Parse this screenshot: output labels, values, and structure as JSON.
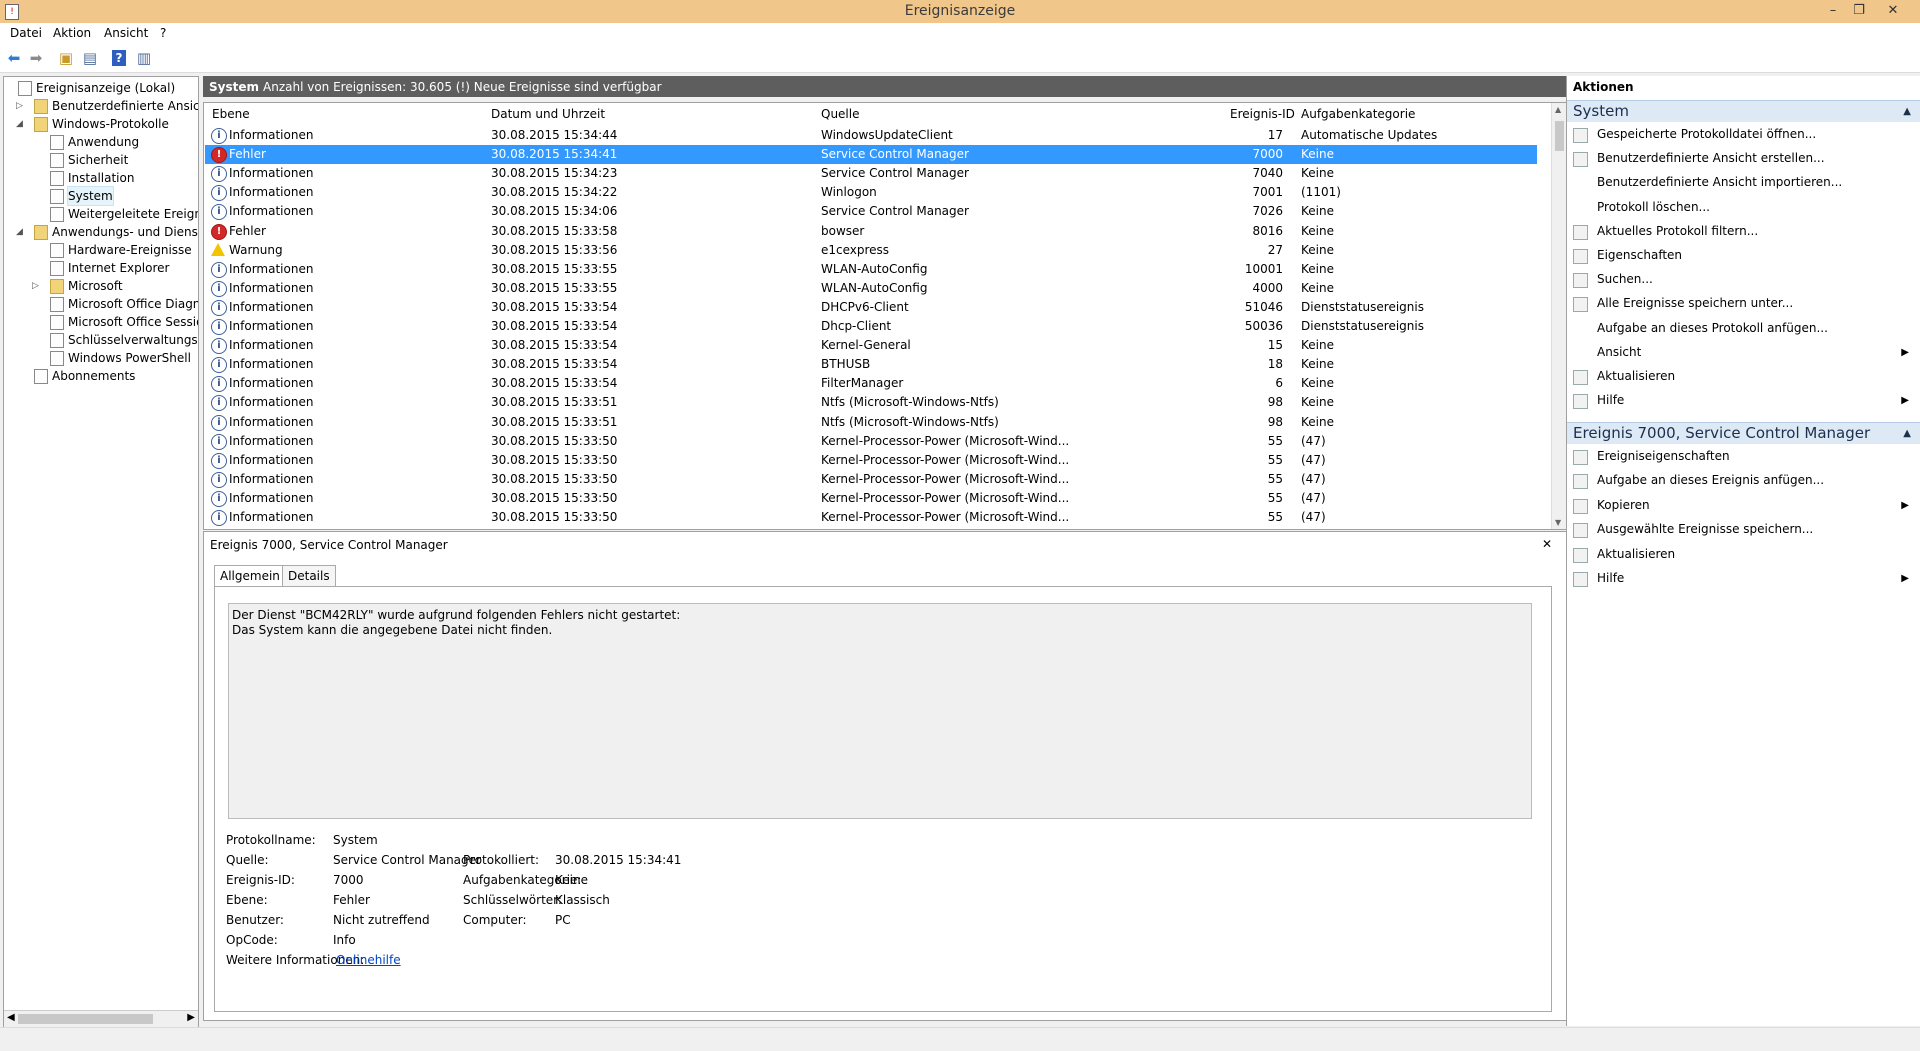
{
  "window": {
    "title": "Ereignisanzeige",
    "minimize": "–",
    "restore": "❐",
    "close": "✕"
  },
  "menu": [
    "Datei",
    "Aktion",
    "Ansicht",
    "?"
  ],
  "toolbar": [
    "back-icon",
    "forward-icon",
    "folder-up-icon",
    "console-tree-icon",
    "help-icon",
    "show-pane-icon"
  ],
  "tree": [
    {
      "label": "Ereignisanzeige (Lokal)",
      "level": 0,
      "expander": "",
      "icon": "eventviewer-icon"
    },
    {
      "label": "Benutzerdefinierte Ansichten",
      "level": 1,
      "expander": "▷",
      "icon": "folder-icon"
    },
    {
      "label": "Windows-Protokolle",
      "level": 1,
      "expander": "◢",
      "icon": "folder-icon"
    },
    {
      "label": "Anwendung",
      "level": 2,
      "expander": "",
      "icon": "log-icon"
    },
    {
      "label": "Sicherheit",
      "level": 2,
      "expander": "",
      "icon": "log-icon"
    },
    {
      "label": "Installation",
      "level": 2,
      "expander": "",
      "icon": "log-icon"
    },
    {
      "label": "System",
      "level": 2,
      "expander": "",
      "icon": "log-icon",
      "selected": true
    },
    {
      "label": "Weitergeleitete Ereignisse",
      "level": 2,
      "expander": "",
      "icon": "log-icon"
    },
    {
      "label": "Anwendungs- und Dienstprotokolle",
      "level": 1,
      "expander": "◢",
      "icon": "folder-icon"
    },
    {
      "label": "Hardware-Ereignisse",
      "level": 2,
      "expander": "",
      "icon": "log-icon"
    },
    {
      "label": "Internet Explorer",
      "level": 2,
      "expander": "",
      "icon": "log-icon"
    },
    {
      "label": "Microsoft",
      "level": 2,
      "expander": "▷",
      "icon": "folder-icon"
    },
    {
      "label": "Microsoft Office Diagnostics",
      "level": 2,
      "expander": "",
      "icon": "log-icon"
    },
    {
      "label": "Microsoft Office Sessions",
      "level": 2,
      "expander": "",
      "icon": "log-icon"
    },
    {
      "label": "Schlüsselverwaltungsdienst",
      "level": 2,
      "expander": "",
      "icon": "log-icon"
    },
    {
      "label": "Windows PowerShell",
      "level": 2,
      "expander": "",
      "icon": "log-icon"
    },
    {
      "label": "Abonnements",
      "level": 1,
      "expander": "",
      "icon": "subscription-icon"
    }
  ],
  "header": {
    "log_name": "System",
    "summary": "Anzahl von Ereignissen: 30.605 (!) Neue Ereignisse sind verfügbar"
  },
  "columns": [
    "Ebene",
    "Datum und Uhrzeit",
    "Quelle",
    "Ereignis-ID",
    "Aufgabenkategorie"
  ],
  "events": [
    {
      "level": "Informationen",
      "type": "info",
      "date": "30.08.2015 15:34:44",
      "source": "WindowsUpdateClient",
      "id": "17",
      "category": "Automatische Updates"
    },
    {
      "level": "Fehler",
      "type": "err",
      "date": "30.08.2015 15:34:41",
      "source": "Service Control Manager",
      "id": "7000",
      "category": "Keine",
      "selected": true
    },
    {
      "level": "Informationen",
      "type": "info",
      "date": "30.08.2015 15:34:23",
      "source": "Service Control Manager",
      "id": "7040",
      "category": "Keine"
    },
    {
      "level": "Informationen",
      "type": "info",
      "date": "30.08.2015 15:34:22",
      "source": "Winlogon",
      "id": "7001",
      "category": "(1101)"
    },
    {
      "level": "Informationen",
      "type": "info",
      "date": "30.08.2015 15:34:06",
      "source": "Service Control Manager",
      "id": "7026",
      "category": "Keine"
    },
    {
      "level": "Fehler",
      "type": "err",
      "date": "30.08.2015 15:33:58",
      "source": "bowser",
      "id": "8016",
      "category": "Keine"
    },
    {
      "level": "Warnung",
      "type": "warn",
      "date": "30.08.2015 15:33:56",
      "source": "e1cexpress",
      "id": "27",
      "category": "Keine"
    },
    {
      "level": "Informationen",
      "type": "info",
      "date": "30.08.2015 15:33:55",
      "source": "WLAN-AutoConfig",
      "id": "10001",
      "category": "Keine"
    },
    {
      "level": "Informationen",
      "type": "info",
      "date": "30.08.2015 15:33:55",
      "source": "WLAN-AutoConfig",
      "id": "4000",
      "category": "Keine"
    },
    {
      "level": "Informationen",
      "type": "info",
      "date": "30.08.2015 15:33:54",
      "source": "DHCPv6-Client",
      "id": "51046",
      "category": "Dienststatusereignis"
    },
    {
      "level": "Informationen",
      "type": "info",
      "date": "30.08.2015 15:33:54",
      "source": "Dhcp-Client",
      "id": "50036",
      "category": "Dienststatusereignis"
    },
    {
      "level": "Informationen",
      "type": "info",
      "date": "30.08.2015 15:33:54",
      "source": "Kernel-General",
      "id": "15",
      "category": "Keine"
    },
    {
      "level": "Informationen",
      "type": "info",
      "date": "30.08.2015 15:33:54",
      "source": "BTHUSB",
      "id": "18",
      "category": "Keine"
    },
    {
      "level": "Informationen",
      "type": "info",
      "date": "30.08.2015 15:33:54",
      "source": "FilterManager",
      "id": "6",
      "category": "Keine"
    },
    {
      "level": "Informationen",
      "type": "info",
      "date": "30.08.2015 15:33:51",
      "source": "Ntfs (Microsoft-Windows-Ntfs)",
      "id": "98",
      "category": "Keine"
    },
    {
      "level": "Informationen",
      "type": "info",
      "date": "30.08.2015 15:33:51",
      "source": "Ntfs (Microsoft-Windows-Ntfs)",
      "id": "98",
      "category": "Keine"
    },
    {
      "level": "Informationen",
      "type": "info",
      "date": "30.08.2015 15:33:50",
      "source": "Kernel-Processor-Power (Microsoft-Wind...",
      "id": "55",
      "category": "(47)"
    },
    {
      "level": "Informationen",
      "type": "info",
      "date": "30.08.2015 15:33:50",
      "source": "Kernel-Processor-Power (Microsoft-Wind...",
      "id": "55",
      "category": "(47)"
    },
    {
      "level": "Informationen",
      "type": "info",
      "date": "30.08.2015 15:33:50",
      "source": "Kernel-Processor-Power (Microsoft-Wind...",
      "id": "55",
      "category": "(47)"
    },
    {
      "level": "Informationen",
      "type": "info",
      "date": "30.08.2015 15:33:50",
      "source": "Kernel-Processor-Power (Microsoft-Wind...",
      "id": "55",
      "category": "(47)"
    },
    {
      "level": "Informationen",
      "type": "info",
      "date": "30.08.2015 15:33:50",
      "source": "Kernel-Processor-Power (Microsoft-Wind...",
      "id": "55",
      "category": "(47)"
    }
  ],
  "detail": {
    "title": "Ereignis 7000, Service Control Manager",
    "close": "✕",
    "tabs": [
      "Allgemein",
      "Details"
    ],
    "description_line1": "Der Dienst \"BCM42RLY\" wurde aufgrund folgenden Fehlers nicht gestartet:",
    "description_line2": "Das System kann die angegebene Datei nicht finden.",
    "labels": {
      "protokollname": "Protokollname:",
      "quelle": "Quelle:",
      "ereignis_id": "Ereignis-ID:",
      "ebene": "Ebene:",
      "benutzer": "Benutzer:",
      "opcode": "OpCode:",
      "weitere": "Weitere Informationen:",
      "protokolliert": "Protokolliert:",
      "aufgabenkategorie": "Aufgabenkategorie:",
      "schluesselwoerter": "Schlüsselwörter:",
      "computer": "Computer:"
    },
    "values": {
      "protokollname": "System",
      "quelle": "Service Control Manager",
      "ereignis_id": "7000",
      "ebene": "Fehler",
      "benutzer": "Nicht zutreffend",
      "opcode": "Info",
      "weitere": "Onlinehilfe",
      "protokolliert": "30.08.2015 15:34:41",
      "aufgabenkategorie": "Keine",
      "schluesselwoerter": "Klassisch",
      "computer": "PC"
    }
  },
  "actions": {
    "title": "Aktionen",
    "section1": "System",
    "items1": [
      {
        "label": "Gespeicherte Protokolldatei öffnen...",
        "icon": "open-folder-icon"
      },
      {
        "label": "Benutzerdefinierte Ansicht erstellen...",
        "icon": "filter-icon"
      },
      {
        "label": "Benutzerdefinierte Ansicht importieren...",
        "icon": ""
      },
      {
        "label": "Protokoll löschen...",
        "icon": ""
      },
      {
        "label": "Aktuelles Protokoll filtern...",
        "icon": "filter-icon"
      },
      {
        "label": "Eigenschaften",
        "icon": "properties-icon"
      },
      {
        "label": "Suchen...",
        "icon": "binoculars-icon"
      },
      {
        "label": "Alle Ereignisse speichern unter...",
        "icon": "save-icon"
      },
      {
        "label": "Aufgabe an dieses Protokoll anfügen...",
        "icon": ""
      },
      {
        "label": "Ansicht",
        "icon": "",
        "submenu": true
      },
      {
        "label": "Aktualisieren",
        "icon": "refresh-icon"
      },
      {
        "label": "Hilfe",
        "icon": "help-icon",
        "submenu": true
      }
    ],
    "section2": "Ereignis 7000, Service Control Manager",
    "items2": [
      {
        "label": "Ereigniseigenschaften",
        "icon": "properties-icon"
      },
      {
        "label": "Aufgabe an dieses Ereignis anfügen...",
        "icon": "task-icon"
      },
      {
        "label": "Kopieren",
        "icon": "copy-icon",
        "submenu": true
      },
      {
        "label": "Ausgewählte Ereignisse speichern...",
        "icon": "save-icon"
      },
      {
        "label": "Aktualisieren",
        "icon": "refresh-icon"
      },
      {
        "label": "Hilfe",
        "icon": "help-icon",
        "submenu": true
      }
    ],
    "collapse": "▲",
    "submenu_arrow": "▶"
  }
}
